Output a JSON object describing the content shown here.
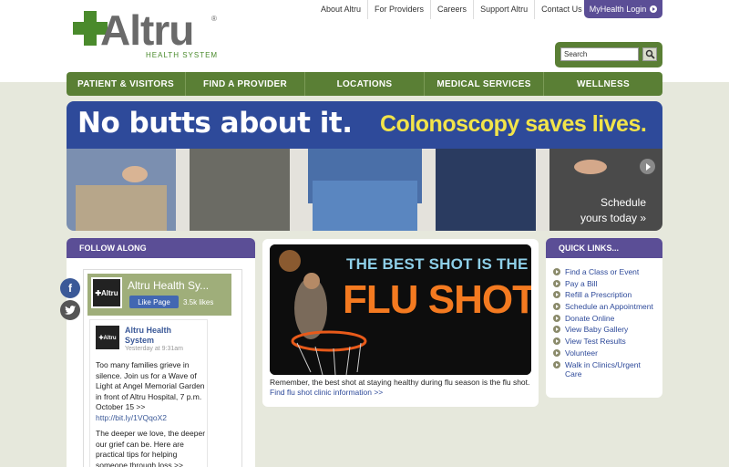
{
  "header": {
    "logo_text": "Altru",
    "logo_sub": "HEALTH SYSTEM",
    "top_links": [
      "About Altru",
      "For Providers",
      "Careers",
      "Support Altru",
      "Contact Us"
    ],
    "myhealth_label": "MyHealth Login"
  },
  "search": {
    "value": "Search"
  },
  "nav": [
    "PATIENT & VISITORS",
    "FIND A PROVIDER",
    "LOCATIONS",
    "MEDICAL SERVICES",
    "WELLNESS"
  ],
  "hero": {
    "headline": "No butts about it.",
    "tagline": "Colonoscopy saves lives.",
    "cta_line1": "Schedule",
    "cta_line2": "yours today »"
  },
  "follow": {
    "title": "FOLLOW ALONG",
    "fb_page_name": "Altru Health Sy...",
    "fb_like_label": "Like Page",
    "fb_likes": "3.5k likes",
    "post_author": "Altru Health System",
    "post_time": "Yesterday at 9:31am",
    "post_text1": "Too many families grieve in silence. Join us for a Wave of Light at Angel Memorial Garden in front of Altru Hospital, 7 p.m. October 15 >>",
    "post_link": "http://bit.ly/1VQqoX2",
    "post_text2": "The deeper we love, the deeper our grief can be. Here are practical tips for helping someone through loss >>"
  },
  "flu": {
    "headline1": "THE BEST SHOT IS THE",
    "headline2": "FLU SHOT",
    "caption": "Remember, the best shot at staying healthy during flu season is the flu shot.",
    "caption_link": "Find flu shot clinic information >>"
  },
  "quick_links": {
    "title": "QUICK LINKS...",
    "items": [
      "Find a Class or Event",
      "Pay a Bill",
      "Refill a Prescription",
      "Schedule an Appointment",
      "Donate Online",
      "View Baby Gallery",
      "View Test Results",
      "Volunteer",
      "Walk in Clinics/Urgent Care"
    ]
  }
}
